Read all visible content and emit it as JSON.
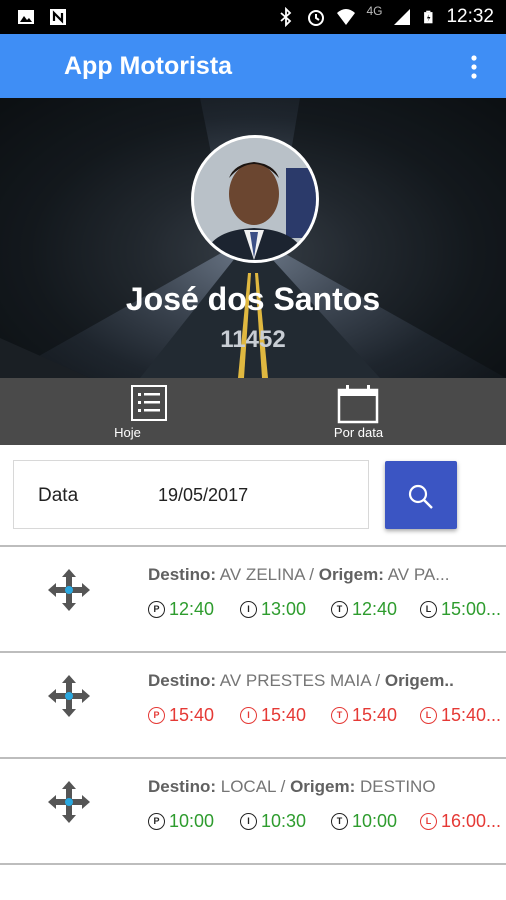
{
  "status_bar": {
    "time": "12:32",
    "network": "4G"
  },
  "app_bar": {
    "title": "App Motorista"
  },
  "profile": {
    "name": "José dos Santos",
    "code": "11452"
  },
  "tabs": [
    {
      "label": "Hoje",
      "icon": "list-icon"
    },
    {
      "label": "Por data",
      "icon": "calendar-icon"
    }
  ],
  "search": {
    "label": "Data",
    "value": "19/05/2017",
    "button_icon": "search-icon"
  },
  "colors": {
    "accent": "#3f8ef5",
    "button": "#3b55c3",
    "green": "#2e9c2e",
    "red": "#e53935"
  },
  "trips": [
    {
      "destino_label": "Destino:",
      "destino": "AV ZELINA",
      "sep": "/",
      "origem_label": "Origem:",
      "origem": "AV PA...",
      "status": "green",
      "times": [
        {
          "letter": "P",
          "value": "12:40"
        },
        {
          "letter": "I",
          "value": "13:00"
        },
        {
          "letter": "T",
          "value": "12:40"
        },
        {
          "letter": "L",
          "value": "15:00..."
        }
      ]
    },
    {
      "destino_label": "Destino:",
      "destino": "AV PRESTES MAIA",
      "sep": "/",
      "origem_label": "Origem..",
      "origem": "",
      "status": "red",
      "times": [
        {
          "letter": "P",
          "value": "15:40"
        },
        {
          "letter": "I",
          "value": "15:40"
        },
        {
          "letter": "T",
          "value": "15:40"
        },
        {
          "letter": "L",
          "value": "15:40..."
        }
      ]
    },
    {
      "destino_label": "Destino:",
      "destino": "LOCAL",
      "sep": "/",
      "origem_label": "Origem:",
      "origem": "DESTINO",
      "status": "mixed",
      "times": [
        {
          "letter": "P",
          "value": "10:00",
          "color": "green"
        },
        {
          "letter": "I",
          "value": "10:30",
          "color": "green"
        },
        {
          "letter": "T",
          "value": "10:00",
          "color": "green"
        },
        {
          "letter": "L",
          "value": "16:00...",
          "color": "red"
        }
      ]
    }
  ]
}
